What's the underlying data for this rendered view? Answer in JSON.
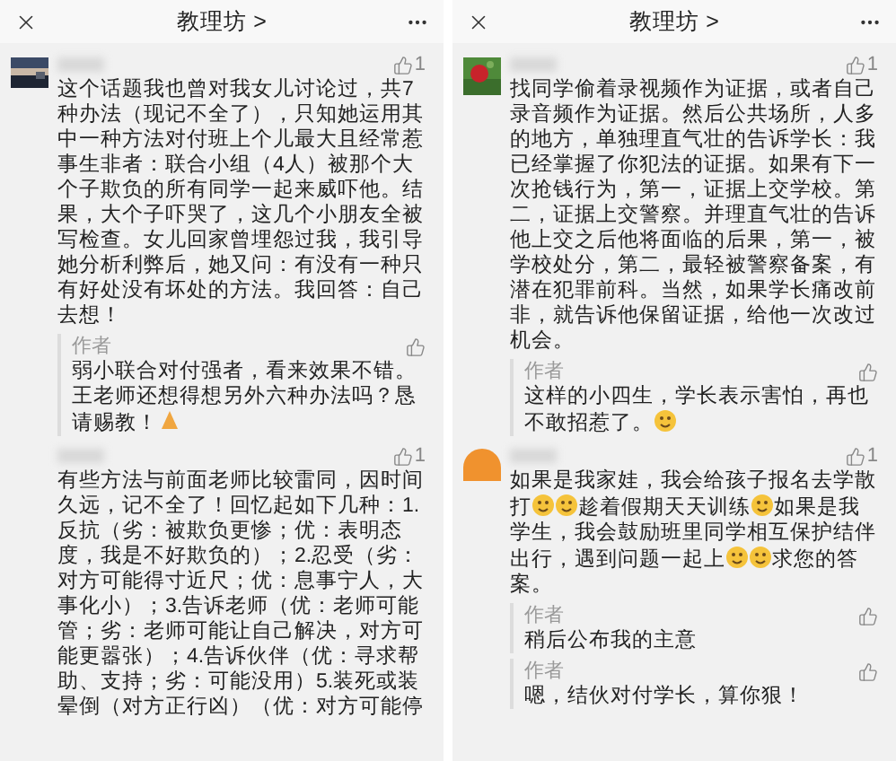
{
  "panels": [
    {
      "header": {
        "title": "教理坊 >"
      },
      "comments": [
        {
          "avatar": {
            "kind": "picture"
          },
          "likes": "1",
          "parts": [
            {
              "kind": "text",
              "text": "这个话题我也曾对我女儿讨论过，共7种办法（现记不全了），只知她运用其中一种方法对付班上个儿最大且经常惹事生非者：联合小组（4人）被那个大个子欺负的所有同学一起来威吓他。结果，大个子吓哭了，这几个小朋友全被写检查。女儿回家曾埋怨过我，我引导她分析利弊后，她又问：有没有一种只有好处没有坏处的方法。我回答：自己去想！"
            }
          ],
          "replies": [
            {
              "author": "作者",
              "parts": [
                {
                  "kind": "text",
                  "text": "弱小联合对付强者，看来效果不错。王老师还想得想另外六种办法吗？恳请赐教！"
                },
                {
                  "kind": "hands"
                }
              ]
            }
          ]
        },
        {
          "likes": "1",
          "parts": [
            {
              "kind": "text",
              "text": "有些方法与前面老师比较雷同，因时间久远，记不全了！回忆起如下几种：1.反抗（劣：被欺负更惨；优：表明态度，我是不好欺负的）；2.忍受（劣：对方可能得寸近尺；优：息事宁人，大事化小）；3.告诉老师（优：老师可能管；劣：老师可能让自己解决，对方可能更嚣张）；4.告诉伙伴（优：寻求帮助、支持；劣：可能没用）5.装死或装晕倒（对方正行凶）（优：对方可能停"
            }
          ]
        }
      ]
    },
    {
      "header": {
        "title": "教理坊 >"
      },
      "comments": [
        {
          "avatar": {
            "kind": "picture"
          },
          "likes": "1",
          "parts": [
            {
              "kind": "text",
              "text": "找同学偷着录视频作为证据，或者自己录音频作为证据。然后公共场所，人多的地方，单独理直气壮的告诉学长：我已经掌握了你犯法的证据。如果有下一次抢钱行为，第一，证据上交学校。第二，证据上交警察。并理直气壮的告诉他上交之后他将面临的后果，第一，被学校处分，第二，最轻被警察备案，有潜在犯罪前科。当然，如果学长痛改前非，就告诉他保留证据，给他一次改过机会。"
            }
          ],
          "replies": [
            {
              "author": "作者",
              "parts": [
                {
                  "kind": "text",
                  "text": "这样的小四生，学长表示害怕，再也不敢招惹了。"
                },
                {
                  "kind": "face"
                }
              ]
            }
          ]
        },
        {
          "avatar": {
            "kind": "plain"
          },
          "likes": "1",
          "parts": [
            {
              "kind": "text",
              "text": "如果是我家娃，我会给孩子报名去学散打"
            },
            {
              "kind": "face"
            },
            {
              "kind": "face"
            },
            {
              "kind": "text",
              "text": "趁着假期天天训练"
            },
            {
              "kind": "face"
            },
            {
              "kind": "text",
              "text": "如果是我学生，我会鼓励班里同学相互保护结伴出行，遇到问题一起上"
            },
            {
              "kind": "face"
            },
            {
              "kind": "face"
            },
            {
              "kind": "text",
              "text": "求您的答案。"
            }
          ],
          "replies": [
            {
              "author": "作者",
              "parts": [
                {
                  "kind": "text",
                  "text": "稍后公布我的主意"
                }
              ]
            },
            {
              "author": "作者",
              "parts": [
                {
                  "kind": "text",
                  "text": "嗯，结伙对付学长，算你狠！"
                }
              ]
            }
          ]
        }
      ]
    }
  ]
}
